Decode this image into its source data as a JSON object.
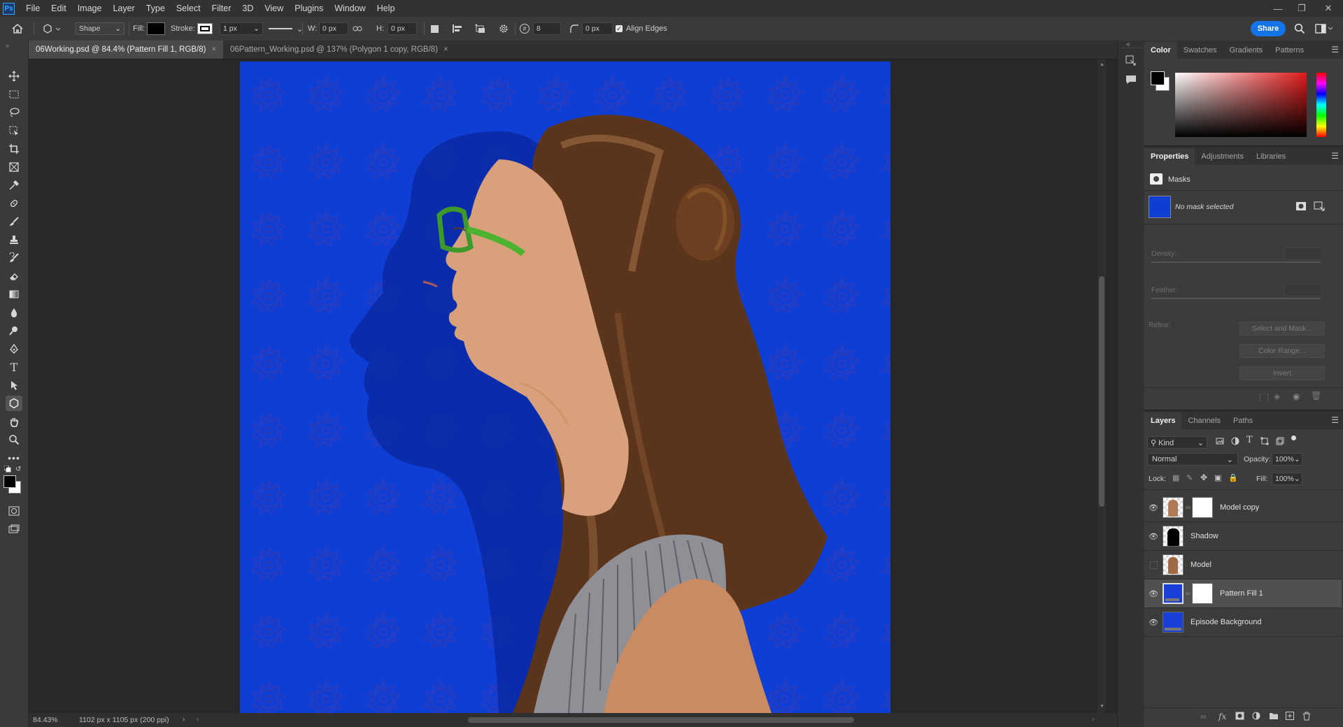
{
  "menu": {
    "logo": "Ps",
    "items": [
      "File",
      "Edit",
      "Image",
      "Layer",
      "Type",
      "Select",
      "Filter",
      "3D",
      "View",
      "Plugins",
      "Window",
      "Help"
    ]
  },
  "options_bar": {
    "shape_mode": "Shape",
    "fill_label": "Fill:",
    "stroke_label": "Stroke:",
    "stroke_width": "1 px",
    "w_label": "W:",
    "w_value": "0 px",
    "h_label": "H:",
    "h_value": "0 px",
    "sides_value": "8",
    "radius_value": "0 px",
    "align_edges": "Align Edges",
    "share": "Share"
  },
  "tabs": [
    {
      "label": "06Working.psd @ 84.4% (Pattern Fill 1, RGB/8)",
      "active": true
    },
    {
      "label": "06Pattern_Working.psd @ 137% (Polygon 1 copy, RGB/8)",
      "active": false
    }
  ],
  "status": {
    "zoom": "84.43%",
    "doc_info": "1102 px x 1105 px (200 ppi)"
  },
  "color_panel": {
    "tabs": [
      "Color",
      "Swatches",
      "Gradients",
      "Patterns"
    ]
  },
  "properties_panel": {
    "tabs": [
      "Properties",
      "Adjustments",
      "Libraries"
    ],
    "section": "Masks",
    "no_mask": "No mask selected",
    "density_label": "Density:",
    "feather_label": "Feather:",
    "refine_label": "Refine:",
    "select_and_mask": "Select and Mask...",
    "color_range": "Color Range...",
    "invert": "Invert"
  },
  "layers_panel": {
    "tabs": [
      "Layers",
      "Channels",
      "Paths"
    ],
    "filter_kind": "Kind",
    "blend_mode": "Normal",
    "opacity_label": "Opacity:",
    "opacity_value": "100%",
    "lock_label": "Lock:",
    "fill_label": "Fill:",
    "fill_value": "100%",
    "layers": [
      {
        "name": "Model copy",
        "visible": true,
        "selected": false
      },
      {
        "name": "Shadow",
        "visible": true,
        "selected": false
      },
      {
        "name": "Model",
        "visible": false,
        "selected": false
      },
      {
        "name": "Pattern Fill 1",
        "visible": true,
        "selected": true
      },
      {
        "name": "Episode Background",
        "visible": true,
        "selected": false
      }
    ]
  },
  "colors": {
    "canvas_blue": "#0f3ed4",
    "pattern_blue": "#2a38b8",
    "shadow_blue": "#0c2aa0",
    "accent": "#1473e6"
  }
}
